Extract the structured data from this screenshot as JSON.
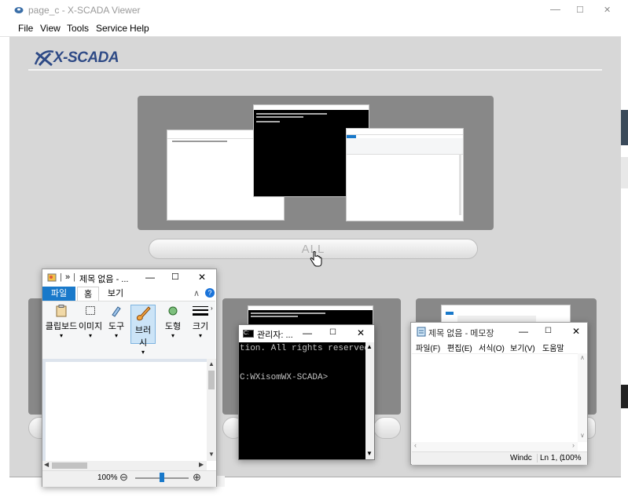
{
  "window": {
    "title": "page_c - X-SCADA Viewer",
    "controls": {
      "minimize": "—",
      "maximize": "☐",
      "close": "✕"
    }
  },
  "menu": {
    "items": [
      "File",
      "View",
      "Tools",
      "Service",
      "Help"
    ]
  },
  "logo": {
    "text": "X-SCADA"
  },
  "main": {
    "all_button": "ALL"
  },
  "paint": {
    "title": "제목 없음 - ...",
    "quick_access": "»",
    "tabs": [
      "파일",
      "홈",
      "보기"
    ],
    "ribbon": [
      "클립보드",
      "이미지",
      "도구",
      "브러시",
      "도형",
      "크기"
    ],
    "zoom_label": "100%",
    "zoom_minus": "⊖",
    "zoom_plus": "⊕",
    "zoom_fraction": 0.5
  },
  "cmd": {
    "title": "관리자: ...",
    "line1": "tion. All rights reserved.",
    "line2": "C:WXisomWX-SCADA>"
  },
  "notepad": {
    "title": "제목 없음 - 메모장",
    "menus": [
      "파일(F)",
      "편집(E)",
      "서식(O)",
      "보기(V)",
      "도움말"
    ],
    "status": [
      "Windc",
      "Ln 1, (",
      "100%"
    ]
  },
  "thumb_cmd_text": "C:WXisomWX-SCADA>",
  "colors": {
    "panel": "#888888",
    "client": "#d7d7d7",
    "accent": "#1979ca",
    "help": "#1a73d9"
  }
}
